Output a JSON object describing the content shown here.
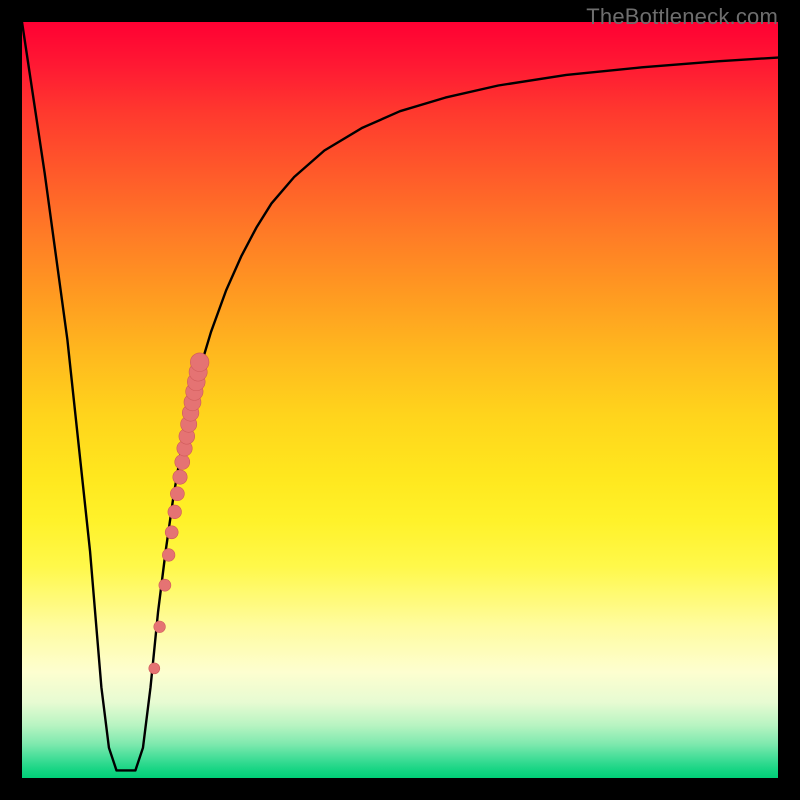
{
  "watermark": {
    "text": "TheBottleneck.com"
  },
  "colors": {
    "curve_stroke": "#000000",
    "dot_fill": "#e57373",
    "dot_stroke": "#cf5a5a",
    "frame": "#000000"
  },
  "chart_data": {
    "type": "line",
    "title": "",
    "xlabel": "",
    "ylabel": "",
    "xlim": [
      0,
      100
    ],
    "ylim": [
      0,
      100
    ],
    "grid": false,
    "curve": {
      "x": [
        0,
        3,
        6,
        9,
        10.5,
        11.5,
        12.5,
        13.5,
        15,
        16,
        17,
        18,
        19,
        20,
        21,
        22,
        23.5,
        25,
        27,
        29,
        31,
        33,
        36,
        40,
        45,
        50,
        56,
        63,
        72,
        82,
        92,
        100
      ],
      "y": [
        100,
        80,
        58,
        30,
        12,
        4,
        1,
        1,
        1,
        4,
        12,
        22,
        30,
        37,
        43,
        48,
        54,
        59,
        64.5,
        69,
        72.8,
        76,
        79.5,
        83,
        86,
        88.2,
        90,
        91.6,
        93,
        94,
        94.8,
        95.3
      ]
    },
    "dots": {
      "note": "small salmon markers along the rising branch of the curve",
      "x": [
        17.5,
        18.2,
        18.9,
        19.4,
        19.8,
        20.2,
        20.55,
        20.9,
        21.2,
        21.5,
        21.8,
        22.05,
        22.3,
        22.55,
        22.8,
        23.05,
        23.3,
        23.5
      ],
      "y": [
        14.5,
        20.0,
        25.5,
        29.5,
        32.5,
        35.2,
        37.6,
        39.8,
        41.8,
        43.6,
        45.2,
        46.8,
        48.3,
        49.7,
        51.1,
        52.4,
        53.7,
        55.0
      ],
      "r": [
        5.5,
        5.8,
        6.0,
        6.3,
        6.5,
        6.8,
        7.0,
        7.2,
        7.5,
        7.7,
        7.9,
        8.1,
        8.3,
        8.5,
        8.7,
        8.9,
        9.1,
        9.3
      ]
    }
  }
}
